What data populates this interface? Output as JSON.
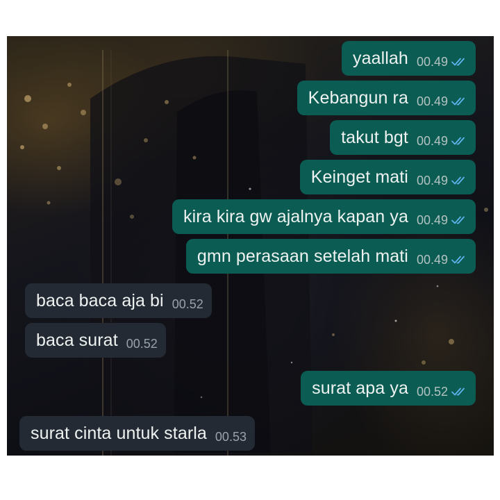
{
  "chat": {
    "messages": [
      {
        "text": "yaallah",
        "time": "00.49",
        "status": "read",
        "direction": "outgoing"
      },
      {
        "text": "Kebangun ra",
        "time": "00.49",
        "status": "read",
        "direction": "outgoing"
      },
      {
        "text": "takut bgt",
        "time": "00.49",
        "status": "read",
        "direction": "outgoing"
      },
      {
        "text": "Keinget mati",
        "time": "00.49",
        "status": "read",
        "direction": "outgoing"
      },
      {
        "text": "kira kira gw ajalnya kapan ya",
        "time": "00.49",
        "status": "read",
        "direction": "outgoing"
      },
      {
        "text": "gmn perasaan setelah mati",
        "time": "00.49",
        "status": "read",
        "direction": "outgoing"
      },
      {
        "text": "baca baca aja bi",
        "time": "00.52",
        "direction": "incoming"
      },
      {
        "text": "baca surat",
        "time": "00.52",
        "direction": "incoming"
      },
      {
        "text": "surat apa ya",
        "time": "00.52",
        "status": "read",
        "direction": "outgoing"
      },
      {
        "text": "surat cinta untuk starla",
        "time": "00.53",
        "direction": "incoming"
      }
    ]
  },
  "icons": {
    "read_receipt": "double-check-icon"
  },
  "colors": {
    "outgoing_bubble": "#0b5c53",
    "incoming_bubble": "#232a33",
    "read_tick": "#5fb2ee",
    "page_background": "#ffffff"
  }
}
